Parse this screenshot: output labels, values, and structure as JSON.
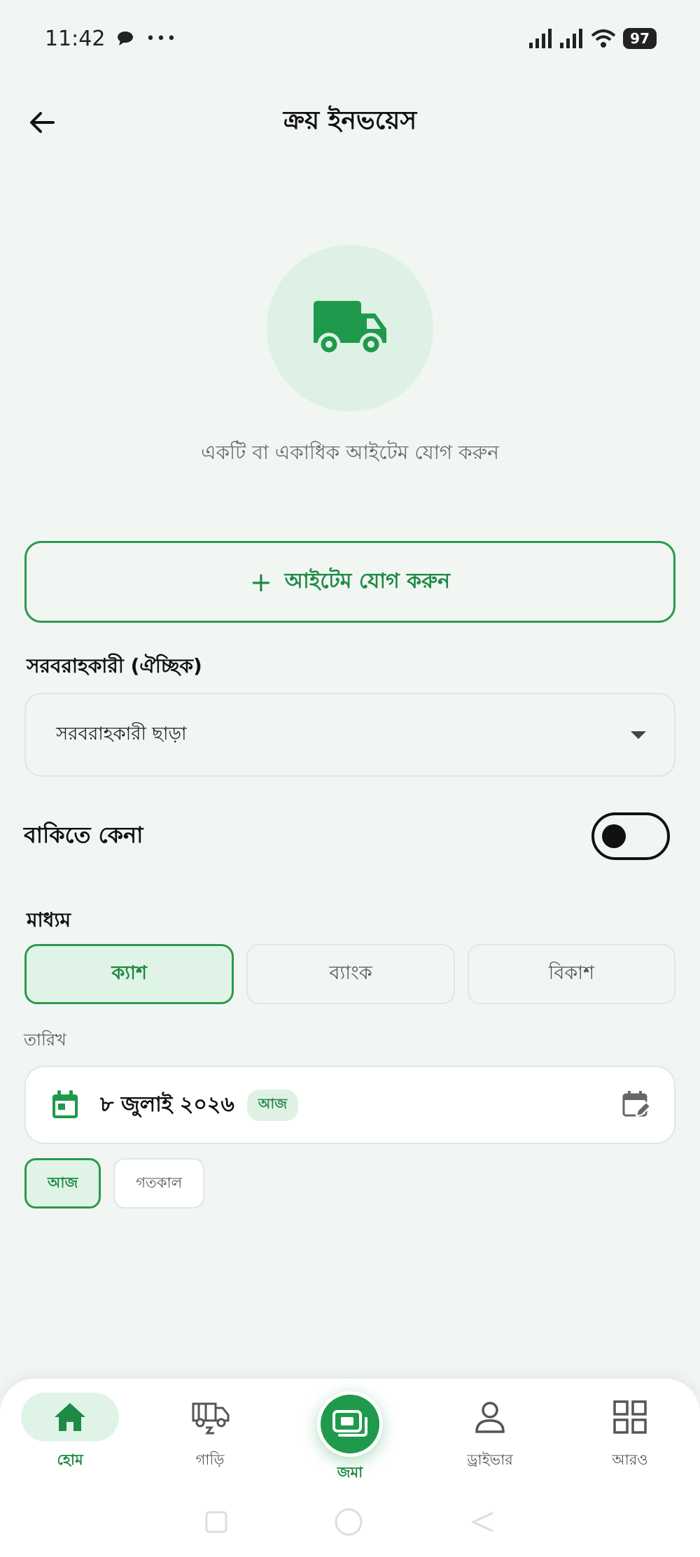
{
  "status_bar": {
    "time": "11:42",
    "dots": "•••",
    "battery": "97"
  },
  "header": {
    "title": "ক্রয় ইনভয়েস"
  },
  "hero": {
    "hint": "একটি বা একাধিক আইটেম যোগ করুন"
  },
  "add_item": {
    "plus": "+",
    "label": "আইটেম যোগ করুন"
  },
  "supplier": {
    "label": "সরবরাহকারী (ঐচ্ছিক)",
    "selected": "সরবরাহকারী ছাড়া"
  },
  "credit": {
    "label": "বাকিতে কেনা",
    "enabled": false
  },
  "method": {
    "label": "মাধ্যম",
    "options": [
      "ক্যাশ",
      "ব্যাংক",
      "বিকাশ"
    ],
    "selected": "ক্যাশ"
  },
  "date": {
    "label": "তারিখ",
    "value": "৮ জুলাই ২০২৬",
    "badge": "আজ",
    "quick": [
      "আজ",
      "গতকাল"
    ]
  },
  "bottom_nav": {
    "items": [
      "হোম",
      "গাড়ি",
      "জমা",
      "ড্রাইভার",
      "আরও"
    ],
    "active": "হোম"
  },
  "colors": {
    "accent": "#1f9a4c",
    "accent_light": "#dff4e6",
    "background": "#f1f6f3"
  }
}
